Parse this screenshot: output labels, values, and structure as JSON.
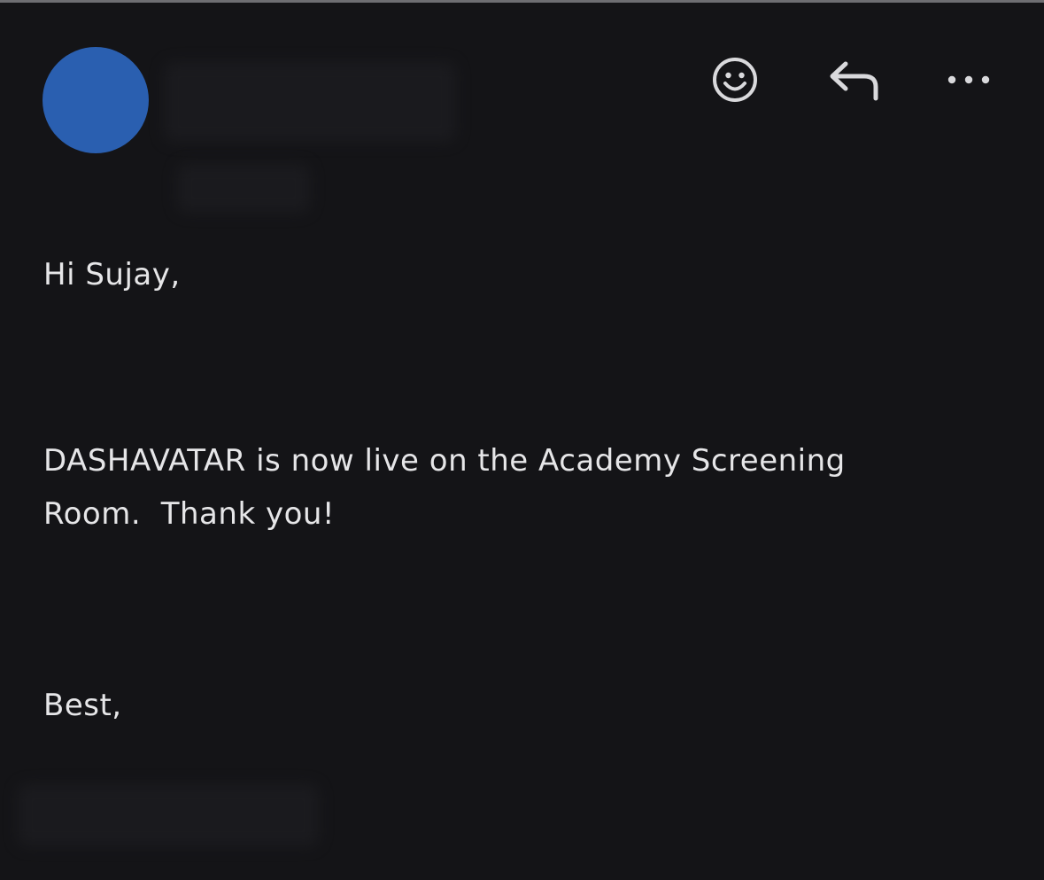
{
  "header": {
    "avatar_color": "#2a5fb0",
    "actions": [
      {
        "name": "emoji-reaction",
        "icon": "smiley-icon"
      },
      {
        "name": "reply",
        "icon": "reply-arrow-icon"
      },
      {
        "name": "more-options",
        "icon": "ellipsis-icon"
      }
    ]
  },
  "email": {
    "greeting": "Hi Sujay,",
    "message": "DASHAVATAR is now live on the Academy Screening Room.  Thank you!",
    "signoff": "Best,"
  },
  "colors": {
    "background": "#141417",
    "text": "#e6e6e8",
    "icon": "#d9d9dc"
  }
}
